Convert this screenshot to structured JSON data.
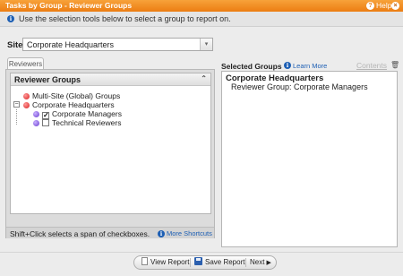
{
  "window": {
    "title": "Tasks by Group - Reviewer Groups",
    "help_label": "Help",
    "help_icon": "?",
    "close_icon": "×"
  },
  "info": {
    "icon": "i",
    "message": "Use the selection tools below to select a group to report on."
  },
  "site": {
    "label": "Site",
    "value": "Corporate Headquarters",
    "arrow": "▾"
  },
  "tabs": [
    {
      "label": "Reviewers"
    }
  ],
  "reviewer_groups": {
    "header": "Reviewer Groups",
    "collapse_icon": "⌃",
    "tree": {
      "root1": "Multi-Site (Global) Groups",
      "root2": "Corporate Headquarters",
      "expander": "−",
      "children": [
        {
          "label": "Corporate Managers",
          "checked": true,
          "check": "✓"
        },
        {
          "label": "Technical Reviewers",
          "checked": false,
          "check": ""
        }
      ]
    }
  },
  "status": {
    "text": "Shift+Click selects a span of checkboxes.",
    "more": "More Shortcuts",
    "icon": "i"
  },
  "selected": {
    "label": "Selected Groups",
    "learn_more": "Learn More",
    "info_icon": "i",
    "contents": "Contents",
    "trash_icon": "🗑",
    "group": "Corporate Headquarters",
    "item": "Reviewer Group: Corporate Managers"
  },
  "footer": {
    "view_report": "View Report",
    "save_report": "Save Report",
    "next": "Next",
    "next_arrow": "▶"
  },
  "colors": {
    "title_bar": "#ec7d12",
    "link": "#1d5fb4",
    "background": "#ececec"
  }
}
